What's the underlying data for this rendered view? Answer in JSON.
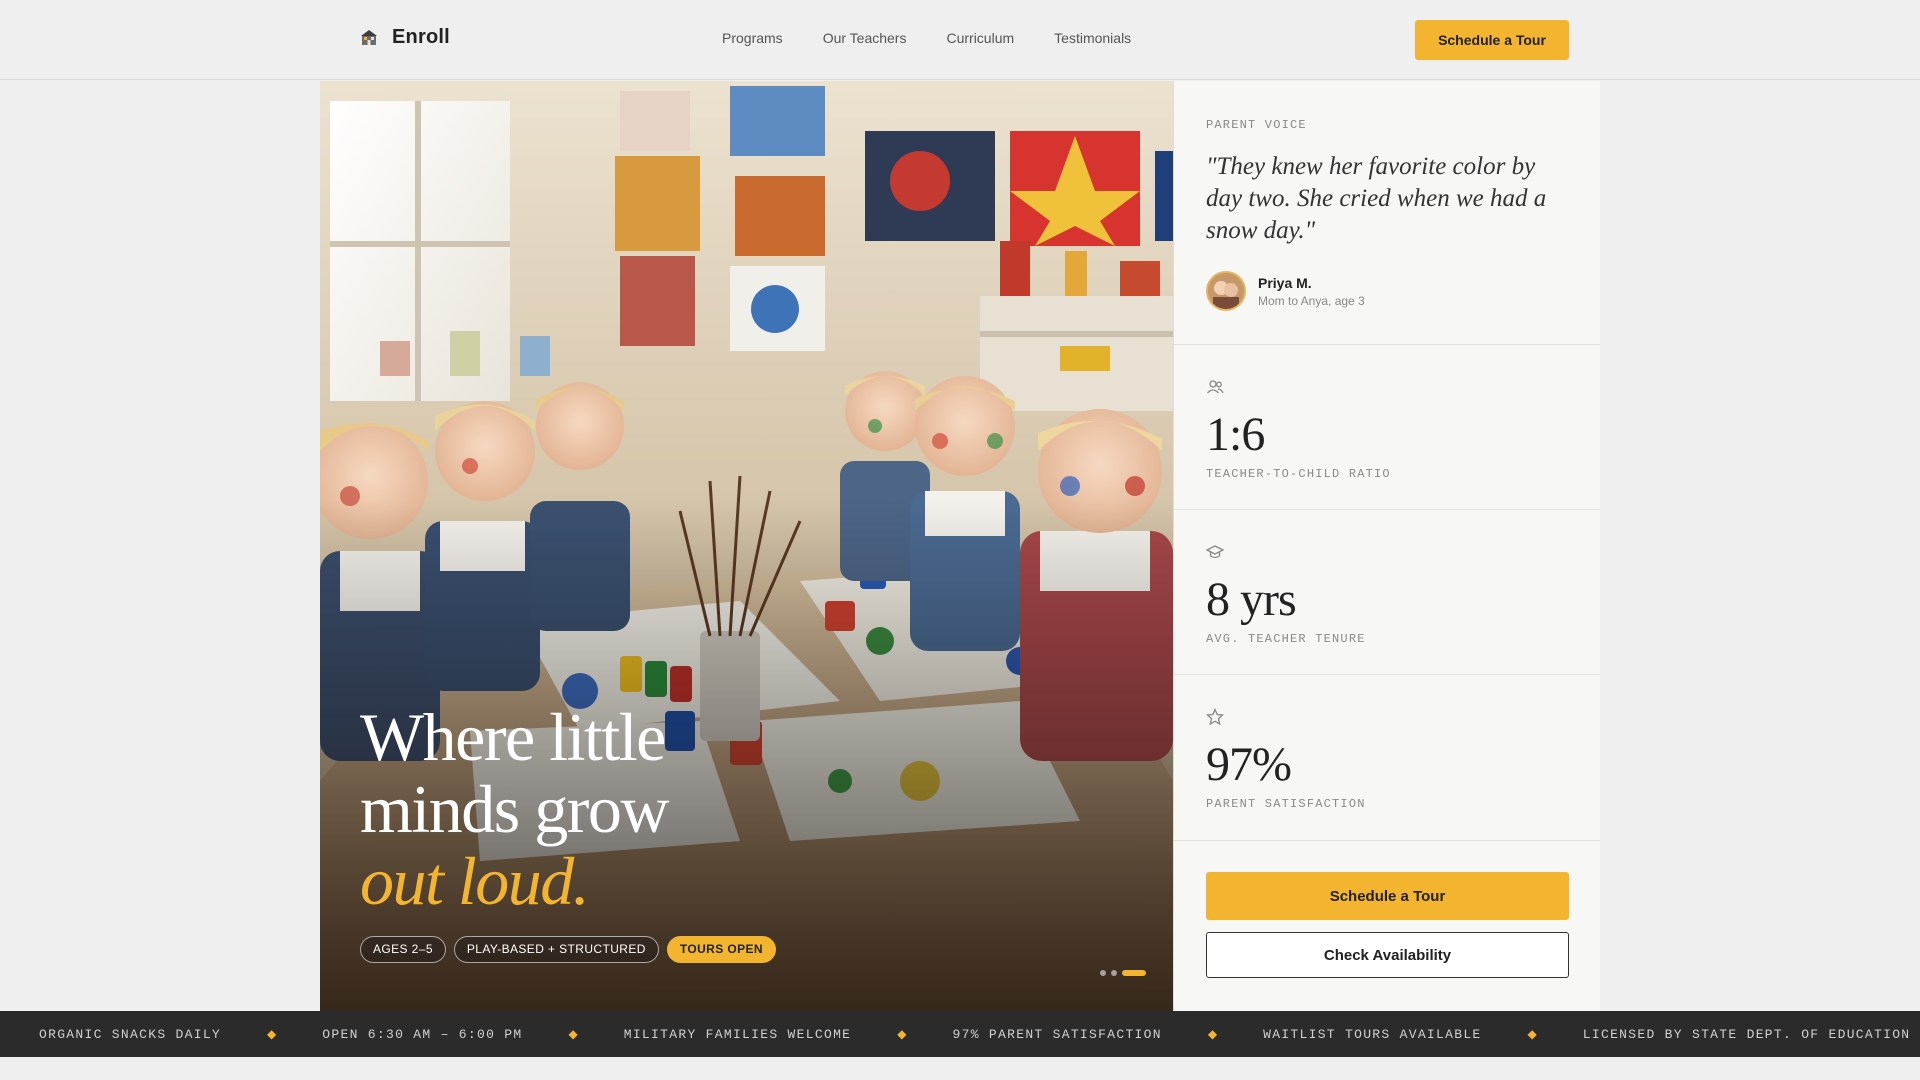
{
  "header": {
    "brand_name": "Enroll",
    "nav": [
      "Programs",
      "Our Teachers",
      "Curriculum",
      "Testimonials"
    ],
    "cta_label": "Schedule a Tour"
  },
  "hero": {
    "headline_line1": "Where little",
    "headline_line2": "minds grow",
    "headline_accent": "out loud.",
    "chips": [
      "AGES 2–5",
      "PLAY-BASED + STRUCTURED",
      "TOURS OPEN"
    ],
    "slide_count": 3,
    "active_slide": 3
  },
  "testimonial": {
    "eyebrow": "PARENT VOICE",
    "quote": "\"They knew her favorite color by day two. She cried when we had a snow day.\"",
    "author_name": "Priya M.",
    "author_sub": "Mom to Anya, age 3"
  },
  "stats": [
    {
      "icon": "users-icon",
      "value": "1:6",
      "label": "TEACHER-TO-CHILD RATIO"
    },
    {
      "icon": "graduation-cap-icon",
      "value": "8 yrs",
      "label": "AVG. TEACHER TENURE"
    },
    {
      "icon": "star-icon",
      "value": "97%",
      "label": "PARENT SATISFACTION"
    }
  ],
  "actions": {
    "primary_label": "Schedule a Tour",
    "secondary_label": "Check Availability"
  },
  "ticker": [
    "ORGANIC SNACKS DAILY",
    "OPEN 6:30 AM – 6:00 PM",
    "MILITARY FAMILIES WELCOME",
    "97% PARENT SATISFACTION",
    "WAITLIST TOURS AVAILABLE",
    "LICENSED BY STATE DEPT. OF EDUCATION"
  ],
  "colors": {
    "accent": "#f3b52f",
    "dark": "#2b2b2b",
    "background": "#efefef"
  }
}
